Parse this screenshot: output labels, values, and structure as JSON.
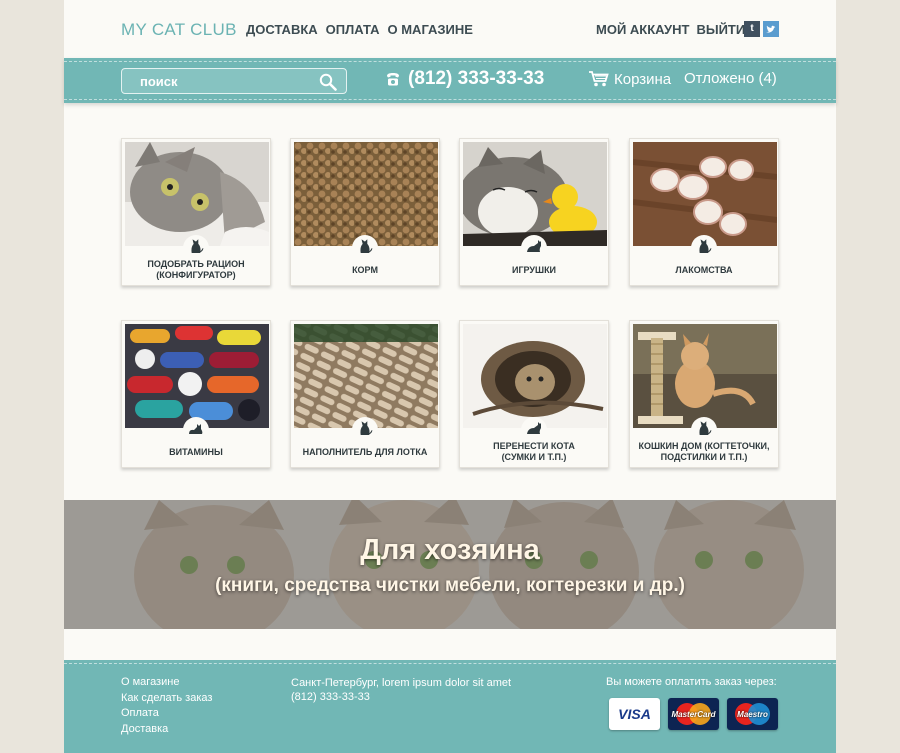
{
  "logo": "MY CAT CLUB",
  "topnav": [
    "ДОСТАВКА",
    "ОПЛАТА",
    "О МАГАЗИНЕ"
  ],
  "account": {
    "my_account": "МОЙ АККАУНТ",
    "logout": "ВЫЙТИ"
  },
  "social": {
    "tumblr": "t",
    "twitter": "t"
  },
  "search": {
    "placeholder": "поиск"
  },
  "phone": "(812) 333-33-33",
  "cart": {
    "label": "Корзина"
  },
  "saved": "Отложено (4)",
  "colors": {
    "teal": "#71b7b5",
    "logo": "#6bb3b3",
    "nav_text": "#3d4c52"
  },
  "categories": [
    {
      "label": "ПОДОБРАТЬ РАЦИОН\n(КОНФИГУРАТОР)",
      "image": "cat-lying-photo",
      "icon": "cat-sitting-icon"
    },
    {
      "label": "КОРМ",
      "image": "dry-food-photo",
      "icon": "cat-sitting-icon"
    },
    {
      "label": "ИГРУШКИ",
      "image": "cat-with-duck-photo",
      "icon": "cat-crouching-icon"
    },
    {
      "label": "ЛАКОМСТВА",
      "image": "treats-photo",
      "icon": "cat-sitting-icon"
    },
    {
      "label": "ВИТАМИНЫ",
      "image": "pills-photo",
      "icon": "cat-lying-icon"
    },
    {
      "label": "НАПОЛНИТЕЛЬ ДЛЯ ЛОТКА",
      "image": "litter-pellets-photo",
      "icon": "cat-sitting-icon"
    },
    {
      "label": "ПЕРЕНЕСТИ КОТА\n(СУМКИ И Т.П.)",
      "image": "cat-carrier-photo",
      "icon": "cat-crouching-icon"
    },
    {
      "label": "КОШКИН ДОМ (КОГТЕТОЧКИ,\nПОДСТИЛКИ И Т.П.)",
      "image": "kitten-scratching-post-photo",
      "icon": "cat-sitting-icon"
    }
  ],
  "banner": {
    "title": "Для хозяина",
    "subtitle": "(книги, средства чистки мебели, когтерезки и др.)"
  },
  "footer": {
    "links": [
      "О магазине",
      "Как сделать заказ",
      "Оплата",
      "Доставка"
    ],
    "address": "Санкт-Петербург, lorem ipsum dolor sit amet",
    "phone": "(812) 333-33-33",
    "pay_text": "Вы можете оплатить заказ через:",
    "cards": [
      "VISA",
      "MasterCard",
      "Maestro"
    ]
  }
}
